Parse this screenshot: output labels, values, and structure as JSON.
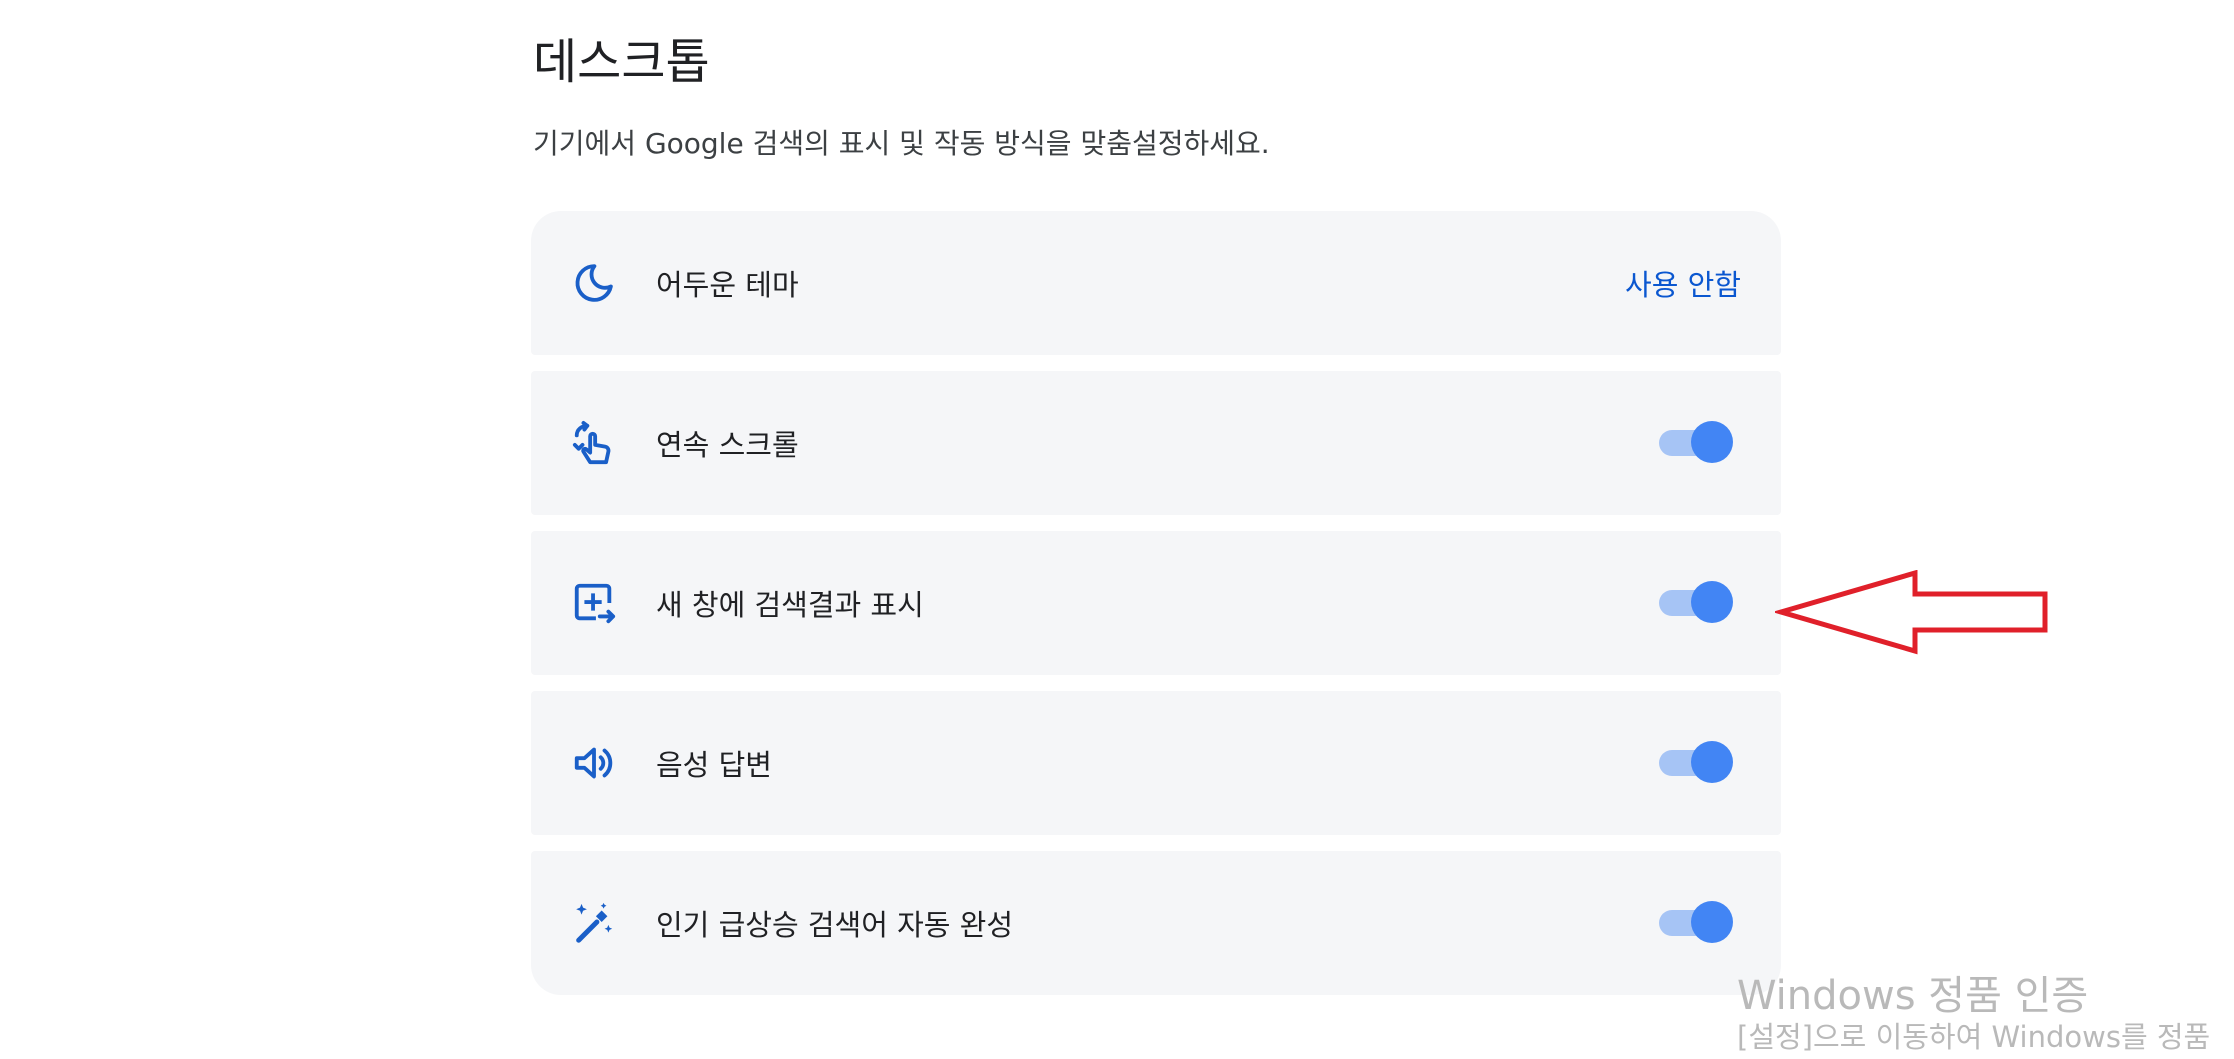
{
  "page": {
    "title": "데스크톱",
    "subtitle": "기기에서 Google 검색의 표시 및 작동 방식을 맞춤설정하세요."
  },
  "settings": [
    {
      "icon": "moon-icon",
      "label": "어두운 테마",
      "value": "사용 안함"
    },
    {
      "icon": "swipe-hand-icon",
      "label": "연속 스크롤",
      "enabled": true
    },
    {
      "icon": "new-window-icon",
      "label": "새 창에 검색결과 표시",
      "enabled": true
    },
    {
      "icon": "speaker-icon",
      "label": "음성 답변",
      "enabled": true
    },
    {
      "icon": "magic-wand-icon",
      "label": "인기 급상승 검색어 자동 완성",
      "enabled": true
    }
  ],
  "annotation": {
    "arrow_color": "#e0202a",
    "points_to": "새 창에 검색결과 표시"
  },
  "watermark": {
    "line1": "Windows 정품 인증",
    "line2": "[설정]으로 이동하여 Windows를 정품"
  },
  "colors": {
    "accent": "#4285f4",
    "link": "#0b57d0",
    "row_bg": "#f5f6f8",
    "icon": "#1a5fc8"
  }
}
